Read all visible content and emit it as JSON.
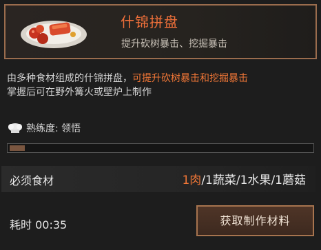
{
  "dish": {
    "title": "什锦拼盘",
    "effect": "提升砍树暴击、挖掘暴击",
    "icon": "mixed-platter-icon"
  },
  "description": {
    "line1_prefix": "由多种食材组成的什锦拼盘，",
    "line1_highlight": "可提升砍树暴击和挖掘暴击",
    "line2": "掌握后可在野外篝火或壁炉上制作"
  },
  "proficiency": {
    "label": "熟练度: 领悟",
    "progress_fraction": 0.05,
    "icon": "chef-hat-icon"
  },
  "ingredients": {
    "label": "必须食材",
    "items": [
      {
        "text": "1肉",
        "sep": "/"
      },
      {
        "text": "1蔬菜",
        "sep": "/"
      },
      {
        "text": "1水果",
        "sep": "/"
      },
      {
        "text": "1蘑菇",
        "sep": ""
      }
    ]
  },
  "craft": {
    "time_label": "耗时 00:35",
    "button_label": "获取制作材料"
  },
  "colors": {
    "accent": "#f07636",
    "frame": "#9a6c4d",
    "background": "#1d1d1d"
  }
}
